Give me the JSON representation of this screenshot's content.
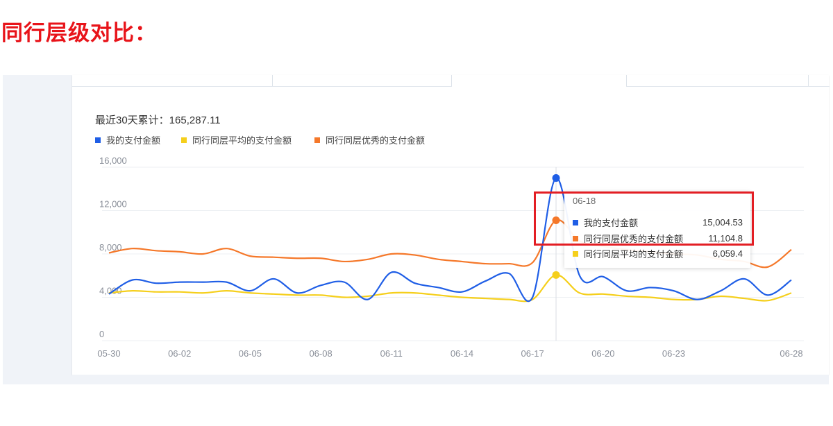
{
  "page_title": "同行层级对比：",
  "summary_text": "最近30天累计：165,287.11",
  "colors": {
    "mine": "#1f5ee6",
    "avg": "#f5cf1c",
    "top": "#f5782a",
    "highlight": "#e31e24"
  },
  "chart_data": {
    "type": "line",
    "x": [
      "05-30",
      "05-31",
      "06-01",
      "06-02",
      "06-03",
      "06-04",
      "06-05",
      "06-06",
      "06-07",
      "06-08",
      "06-09",
      "06-10",
      "06-11",
      "06-12",
      "06-13",
      "06-14",
      "06-15",
      "06-16",
      "06-17",
      "06-18",
      "06-19",
      "06-20",
      "06-21",
      "06-22",
      "06-23",
      "06-24",
      "06-25",
      "06-26",
      "06-27",
      "06-28"
    ],
    "xtick_labels": [
      "05-30",
      "06-02",
      "06-05",
      "06-08",
      "06-11",
      "06-14",
      "06-17",
      "06-20",
      "06-23",
      "06-28"
    ],
    "ylim": [
      0,
      16000
    ],
    "yticks": [
      "0",
      "4,000",
      "8,000",
      "12,000",
      "16,000"
    ],
    "grid": true,
    "legend_position": "top-left",
    "series": [
      {
        "name": "我的支付金额",
        "color": "#1f5ee6",
        "values": [
          4300,
          5600,
          5300,
          5400,
          5400,
          5400,
          4600,
          5700,
          4400,
          5100,
          5400,
          3800,
          6300,
          5300,
          4900,
          4500,
          5500,
          6200,
          4000,
          15004.53,
          6000,
          5900,
          4600,
          4900,
          4600,
          3800,
          4600,
          5700,
          4200,
          5600
        ]
      },
      {
        "name": "同行同层平均的支付金额",
        "color": "#f5cf1c",
        "values": [
          4400,
          4600,
          4500,
          4500,
          4400,
          4600,
          4400,
          4300,
          4200,
          4200,
          4000,
          4100,
          4400,
          4400,
          4200,
          4000,
          3900,
          3800,
          3800,
          6059.4,
          4400,
          4300,
          4100,
          4000,
          3800,
          3800,
          4100,
          3900,
          3700,
          4400
        ]
      },
      {
        "name": "同行同层优秀的支付金额",
        "color": "#f5782a",
        "values": [
          8100,
          8500,
          8300,
          8200,
          8000,
          8500,
          7800,
          7700,
          7600,
          7600,
          7300,
          7500,
          8000,
          7900,
          7500,
          7300,
          7100,
          7100,
          7200,
          11104.8,
          9200,
          8700,
          8400,
          8200,
          8000,
          7900,
          7500,
          7300,
          6800,
          8400
        ]
      }
    ]
  },
  "tooltip": {
    "date": "06-18",
    "rows": [
      {
        "label": "我的支付金额",
        "value": "15,004.53",
        "color": "#1f5ee6"
      },
      {
        "label": "同行同层优秀的支付金额",
        "value": "11,104.8",
        "color": "#f5782a"
      },
      {
        "label": "同行同层平均的支付金额",
        "value": "6,059.4",
        "color": "#f5cf1c"
      }
    ]
  }
}
